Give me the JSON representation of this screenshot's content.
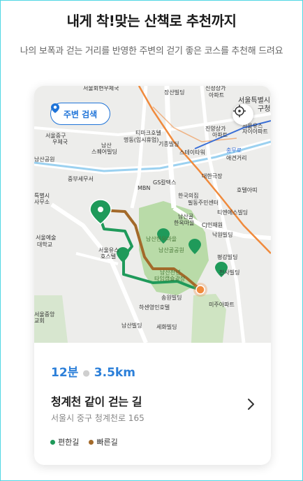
{
  "header": {
    "title": "내게 착!맞는 산책로 추천까지",
    "subtitle": "나의 보폭과 걷는 거리를 반영한 주변의 걷기 좋은 코스를 추천해 드려요"
  },
  "map": {
    "search_button_label": "주변 검색",
    "labels": [
      {
        "text": "서울회현우체국"
      },
      {
        "text": "장산빌딩"
      },
      {
        "text": "신성상가"
      },
      {
        "text": "아파트"
      },
      {
        "text": "서울특별시"
      },
      {
        "text": "구청"
      },
      {
        "text": "진양상가"
      },
      {
        "text": "아파트"
      },
      {
        "text": "서울유스"
      },
      {
        "text": "자이아파트"
      },
      {
        "text": "티마크호텔"
      },
      {
        "text": "명동(임시휴업)"
      },
      {
        "text": "서울중구"
      },
      {
        "text": "우체국"
      },
      {
        "text": "남산"
      },
      {
        "text": "스퀘어빌딩"
      },
      {
        "text": "기종빌딩"
      },
      {
        "text": "스테이타워"
      },
      {
        "text": "충무로"
      },
      {
        "text": "애견거리"
      },
      {
        "text": "대한극장"
      },
      {
        "text": "중부세무서"
      },
      {
        "text": "MBN"
      },
      {
        "text": "GS칼텍스"
      },
      {
        "text": "한국의집"
      },
      {
        "text": "필동주민센터"
      },
      {
        "text": "호텔아띠"
      },
      {
        "text": "티엔에스빌딩"
      },
      {
        "text": "남산골"
      },
      {
        "text": "한옥마을"
      },
      {
        "text": "CJ인재원"
      },
      {
        "text": "낙원빌딩"
      },
      {
        "text": "남산골공원"
      },
      {
        "text": "남산한옥마을"
      },
      {
        "text": "서울유스"
      },
      {
        "text": "호스텔"
      },
      {
        "text": "서울예술"
      },
      {
        "text": "대학교"
      },
      {
        "text": "평강빌딩"
      },
      {
        "text": "남산천년"
      },
      {
        "text": "타임캡슐광장"
      },
      {
        "text": "송원빌딩"
      },
      {
        "text": "하센영인호텔"
      },
      {
        "text": "미주아파트"
      },
      {
        "text": "남산빌딩"
      },
      {
        "text": "세화빌딩"
      },
      {
        "text": "서울중앙"
      },
      {
        "text": "교회"
      },
      {
        "text": "천사빌딩"
      },
      {
        "text": "남산공원"
      },
      {
        "text": "특별시"
      },
      {
        "text": "사무소"
      }
    ]
  },
  "route": {
    "duration": "12분",
    "distance": "3.5km",
    "name": "청계천 같이 걷는 길",
    "address": "서울시 중구 청계천로 165"
  },
  "legend": [
    {
      "label": "편한길",
      "color": "#1f9a5a"
    },
    {
      "label": "빠른길",
      "color": "#a36a2a"
    }
  ],
  "colors": {
    "accent_blue": "#1e73d8",
    "easy_route": "#1f9a5a",
    "fast_route": "#a36a2a",
    "park_green": "#b9dba8",
    "destination": "#f08a3c"
  },
  "icons": {
    "search_pin": "location-pin-icon",
    "locate": "crosshair-icon",
    "chevron": "chevron-right-icon"
  }
}
